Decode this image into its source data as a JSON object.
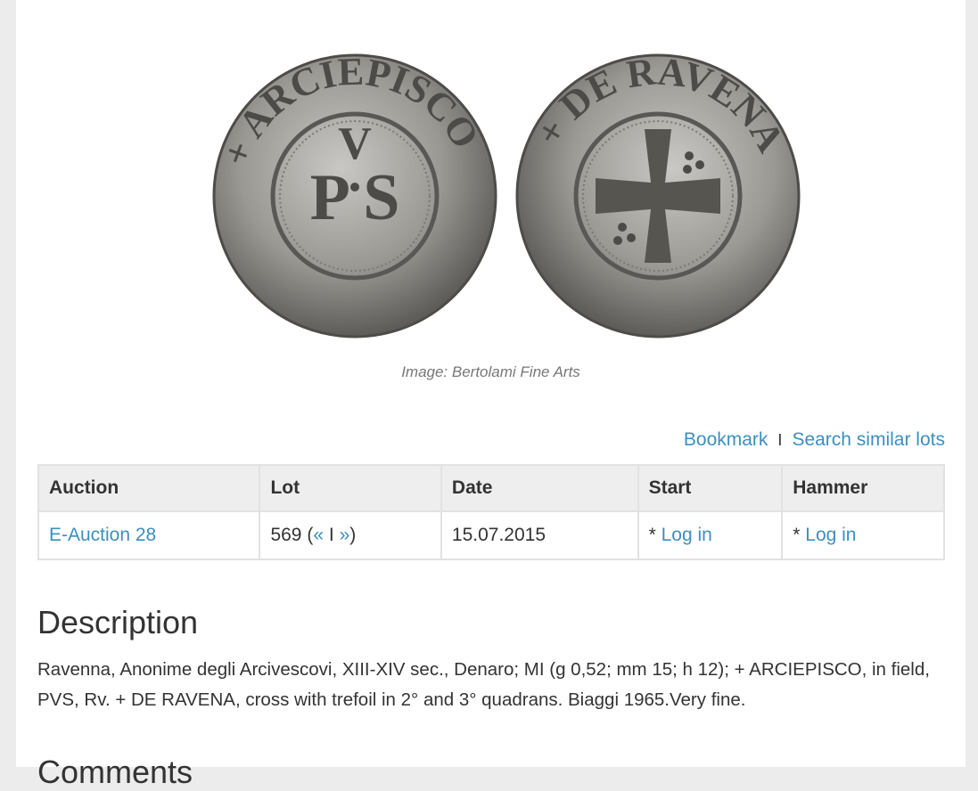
{
  "image": {
    "caption": "Image: Bertolami Fine Arts",
    "obverse_legend": "ARCIEPISCO",
    "obverse_field": "PVS",
    "reverse_legend": "DE RAVENA"
  },
  "actions": {
    "bookmark": "Bookmark",
    "separator": "I",
    "search_similar": "Search similar lots"
  },
  "table": {
    "headers": [
      "Auction",
      "Lot",
      "Date",
      "Start",
      "Hammer"
    ],
    "row": {
      "auction": "E-Auction 28",
      "lot_number": "569",
      "lot_open": "(",
      "prev_link": "«",
      "lot_sep": "I",
      "next_link": "»",
      "lot_close": ")",
      "date": "15.07.2015",
      "start_prefix": "*",
      "start_link": "Log in",
      "hammer_prefix": "*",
      "hammer_link": "Log in"
    }
  },
  "description": {
    "title": "Description",
    "text": "Ravenna, Anonime degli Arcivescovi, XIII-XIV sec., Denaro; MI (g 0,52; mm 15; h 12); + ARCIEPISCO, in field, PVS, Rv. + DE RAVENA, cross with trefoil in 2° and 3° quadrans. Biaggi 1965.Very fine."
  },
  "comments": {
    "title": "Comments"
  }
}
